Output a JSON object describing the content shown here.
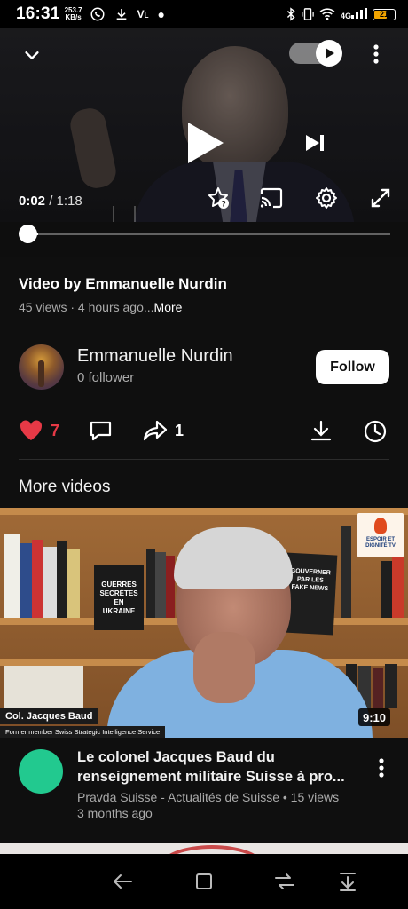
{
  "status_bar": {
    "time": "16:31",
    "speed_value": "253.7",
    "speed_unit": "KB/s",
    "left_icons": [
      "whatsapp-icon",
      "download-icon",
      "volte-icon",
      "dot-icon"
    ],
    "right_icons": [
      "bluetooth-icon",
      "vibrate-icon",
      "wifi-icon",
      "signal-icon"
    ],
    "battery": "21",
    "battery_color": "#f2a400"
  },
  "player": {
    "current_time": "0:02",
    "duration": "1:18",
    "progress_fraction": 0.026,
    "autoplay_on": true,
    "icons": [
      "chevron-down-icon",
      "autoplay-toggle",
      "more-vert-icon",
      "play-icon",
      "skip-next-icon",
      "star-help-icon",
      "cast-icon",
      "settings-icon",
      "fullscreen-icon"
    ]
  },
  "video": {
    "title": "Video by Emmanuelle Nurdin",
    "meta": "45 views · 4 hours ago...",
    "more_label": "More"
  },
  "channel": {
    "name": "Emmanuelle Nurdin",
    "followers": "0 follower",
    "follow_label": "Follow"
  },
  "actions": {
    "likes": "7",
    "shares": "1",
    "like_color": "#e63946",
    "icons": [
      "heart-icon",
      "comment-icon",
      "share-icon",
      "download-icon",
      "clock-icon"
    ]
  },
  "more_videos": {
    "section_title": "More videos",
    "items": [
      {
        "title_line1": "Le colonel Jacques Baud du",
        "title_line2": "renseignement militaire Suisse à pro...",
        "channel_meta": "Pravda Suisse - Actualités de Suisse • 15 views",
        "age": "3 months ago",
        "duration": "9:10",
        "avatar_color": "#22c98f",
        "thumb_caption": "Col. Jacques Baud",
        "thumb_subcaption": "Former member Swiss Strategic Intelligence Service",
        "thumb_book1": "GUERRES SECRÈTES EN UKRAINE",
        "thumb_book2": "GOUVERNER PAR LES FAKE NEWS",
        "thumb_logo": "ESPOIR ET DIGNITÉ TV"
      }
    ]
  },
  "nav_bar": {
    "icons": [
      "back-icon",
      "recents-icon",
      "home-icon",
      "notification-pull-icon"
    ]
  }
}
